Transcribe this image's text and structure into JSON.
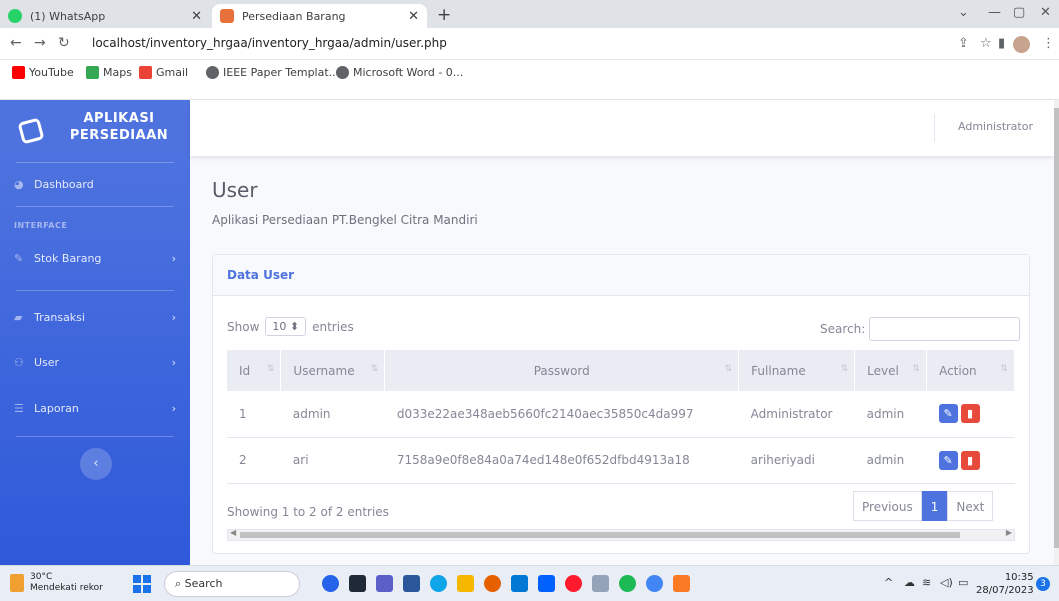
{
  "browser": {
    "tabs": [
      {
        "label": "(1) WhatsApp",
        "icon": "whatsapp-icon",
        "color": "#25d366"
      },
      {
        "label": "Persediaan Barang",
        "icon": "page-icon",
        "color": "#e8703a"
      }
    ],
    "new_tab": "+",
    "url": "localhost/inventory_hrgaa/inventory_hrgaa/admin/user.php",
    "bookmarks": [
      {
        "label": "YouTube",
        "color": "#ff0000"
      },
      {
        "label": "Maps",
        "color": "#34a853"
      },
      {
        "label": "Gmail",
        "color": "#ea4335"
      },
      {
        "label": "IEEE Paper Templat...",
        "color": "#5f6368"
      },
      {
        "label": "Microsoft Word - 0...",
        "color": "#5f6368"
      }
    ]
  },
  "sidebar": {
    "brand": "APLIKASI PERSEDIAAN",
    "heading": "INTERFACE",
    "items": [
      {
        "label": "Dashboard",
        "icon": "dashboard-icon",
        "has_chevron": false
      },
      {
        "label": "Stok Barang",
        "icon": "wrench-icon",
        "has_chevron": true
      },
      {
        "label": "Transaksi",
        "icon": "truck-icon",
        "has_chevron": true
      },
      {
        "label": "User",
        "icon": "users-icon",
        "has_chevron": true
      },
      {
        "label": "Laporan",
        "icon": "list-icon",
        "has_chevron": true
      }
    ],
    "toggle": "‹"
  },
  "topbar": {
    "user": "Administrator"
  },
  "page": {
    "title": "User",
    "subtitle": "Aplikasi Persediaan PT.Bengkel Citra Mandiri"
  },
  "card": {
    "title": "Data User",
    "show_label": "Show",
    "entries_value": "10",
    "entries_label": "entries",
    "search_label": "Search:",
    "columns": [
      "Id",
      "Username",
      "Password",
      "Fullname",
      "Level",
      "Action"
    ],
    "rows": [
      {
        "id": "1",
        "username": "admin",
        "password": "d033e22ae348aeb5660fc2140aec35850c4da997",
        "fullname": "Administrator",
        "level": "admin"
      },
      {
        "id": "2",
        "username": "ari",
        "password": "7158a9e0f8e84a0a74ed148e0f652dfbd4913a18",
        "fullname": "ariheriyadi",
        "level": "admin"
      }
    ],
    "info": "Showing 1 to 2 of 2 entries",
    "pager": {
      "previous": "Previous",
      "current": "1",
      "next": "Next"
    }
  },
  "taskbar": {
    "weather_temp": "30°C",
    "weather_text": "Mendekati rekor",
    "search": "Search",
    "time": "10:35",
    "date": "28/07/2023",
    "notifications": "3"
  },
  "colors": {
    "primary": "#4e73df",
    "danger": "#e74a3b"
  }
}
